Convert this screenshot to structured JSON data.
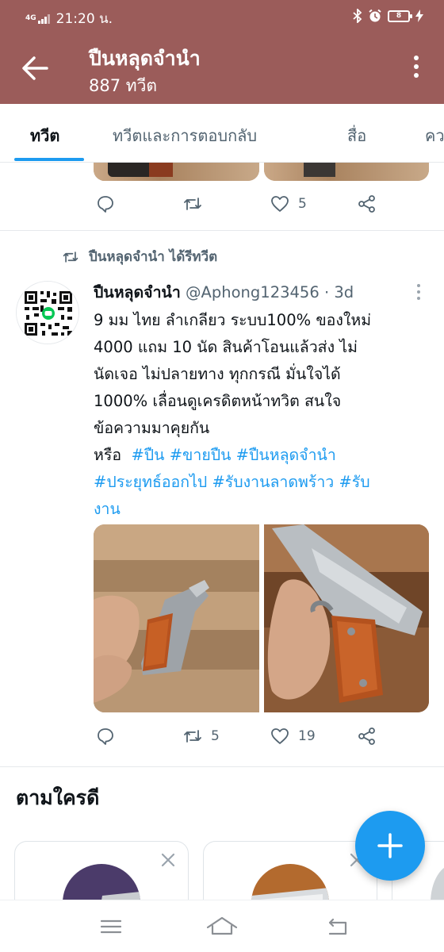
{
  "status_bar": {
    "network": "4G",
    "time": "21:20 น.",
    "battery": "8"
  },
  "app_bar": {
    "title": "ปืนหลุดจำนำ",
    "subtitle": "887 ทวีต"
  },
  "tabs": [
    {
      "label": "ทวีต",
      "active": true
    },
    {
      "label": "ทวีตและการตอบกลับ",
      "active": false
    },
    {
      "label": "สื่อ",
      "active": false
    },
    {
      "label": "คว",
      "active": false
    }
  ],
  "previous_tweet": {
    "likes": "5"
  },
  "tweet": {
    "retweet_label": "ปืนหลุดจำนำ ได้รีทวีต",
    "name": "ปืนหลุดจำนำ",
    "handle": "@Aphong123456",
    "dot": "·",
    "age": "3d",
    "lines": [
      "9 มม ไทย ลำเกลียว ระบบ100% ของใหม่",
      "4000 แถม 10 นัด สินค้าโอนแล้วส่ง ไม่",
      "นัดเจอ ไม่ปลายทาง ทุกกรณี มั่นใจได้",
      "1000% เลื่อนดูเครดิตหน้าทวิต สนใจ",
      "ข้อความมาคุยกัน"
    ],
    "or_word": "หรือ",
    "tags_line1": [
      "#ปืน",
      "#ขายปืน",
      "#ปืนหลุดจำนำ"
    ],
    "tags_line2": [
      "#ประยุทธ์ออกไป",
      "#รับงานลาดพร้าว",
      "#รับ"
    ],
    "tags_line3": [
      "งาน"
    ],
    "retweets": "5",
    "likes": "19"
  },
  "who_to_follow": {
    "title": "ตามใครดี"
  },
  "colors": {
    "app_bar": "#9b5c5a",
    "accent": "#1d9bf0",
    "secondary_text": "#536471"
  },
  "icons": [
    "back-arrow-icon",
    "more-vertical-icon",
    "reply-icon",
    "retweet-icon",
    "like-icon",
    "share-icon",
    "close-icon",
    "compose-plus-icon",
    "menu-icon",
    "home-icon",
    "back-icon"
  ]
}
